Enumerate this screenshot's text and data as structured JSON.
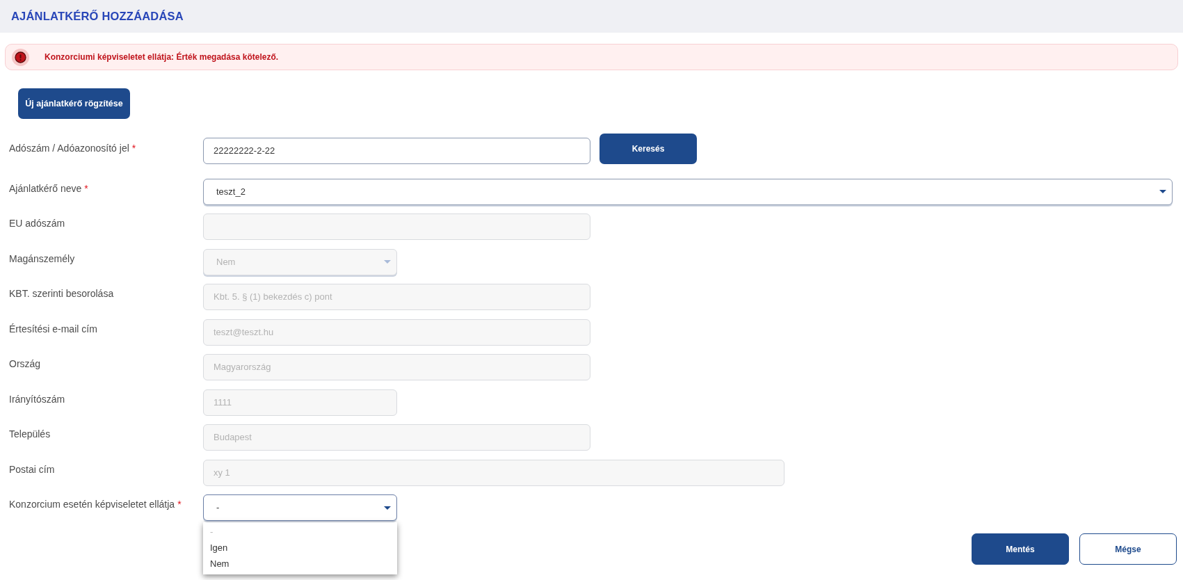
{
  "header": {
    "title": "AJÁNLATKÉRŐ HOZZÁADÁSA"
  },
  "alert": {
    "kind": "error",
    "message": "Konzorciumi képviseletet ellátja: Érték megadása kötelező."
  },
  "new_button": {
    "label": "Új ajánlatkérő rögzítése"
  },
  "fields": [
    {
      "label": "Adószám / Adóazonosító jel",
      "required_mark": "*",
      "kind": "input",
      "disabled": false,
      "value": "22222222-2-22",
      "button": {
        "label": "Keresés"
      }
    },
    {
      "label": "Ajánlatkérő neve",
      "required_mark": "*",
      "kind": "select",
      "disabled": false,
      "expanded": false,
      "value": "teszt_2"
    },
    {
      "label": "EU adószám",
      "kind": "input",
      "disabled": true
    },
    {
      "label": "Magánszemély",
      "kind": "select",
      "disabled": true,
      "expanded": false,
      "value": "Nem"
    },
    {
      "label": "KBT. szerinti besorolása",
      "kind": "input",
      "disabled": true,
      "value": "Kbt. 5. § (1) bekezdés c) pont"
    },
    {
      "label": "Értesítési e-mail cím",
      "kind": "input",
      "disabled": true,
      "value": "teszt@teszt.hu"
    },
    {
      "label": "Ország",
      "kind": "input",
      "disabled": true,
      "value": "Magyarország"
    },
    {
      "label": "Irányítószám",
      "kind": "input",
      "disabled": true,
      "value": "1111"
    },
    {
      "label": "Település",
      "kind": "input",
      "disabled": true,
      "value": "Budapest"
    },
    {
      "label": "Postai cím",
      "kind": "input",
      "disabled": true,
      "value": "xy 1"
    },
    {
      "label": "Konzorcium esetén képviseletet ellátja",
      "required_mark": "*",
      "kind": "select",
      "disabled": false,
      "expanded": true,
      "value": "-",
      "options": [
        {
          "label": "-",
          "disabled": true
        },
        {
          "label": "Igen",
          "disabled": false
        },
        {
          "label": "Nem",
          "disabled": false
        }
      ]
    }
  ],
  "actions": [
    {
      "label": "Mentés",
      "kind": "primary"
    },
    {
      "label": "Mégse",
      "kind": "secondary"
    }
  ]
}
